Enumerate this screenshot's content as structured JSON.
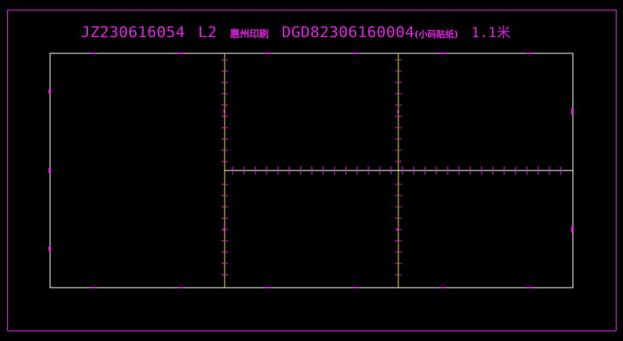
{
  "header": {
    "order_no": "JZ230616054",
    "level": "L2",
    "company": "惠州印刷",
    "dgd_no": "DGD82306160004",
    "material_note": "(小码贴纸)",
    "length": "1.1米"
  },
  "colors": {
    "background": "#000000",
    "frame": "#e020e0",
    "sheet_border": "#ffffff",
    "cut_line": "#e8e800",
    "mark": "#e020e0"
  }
}
